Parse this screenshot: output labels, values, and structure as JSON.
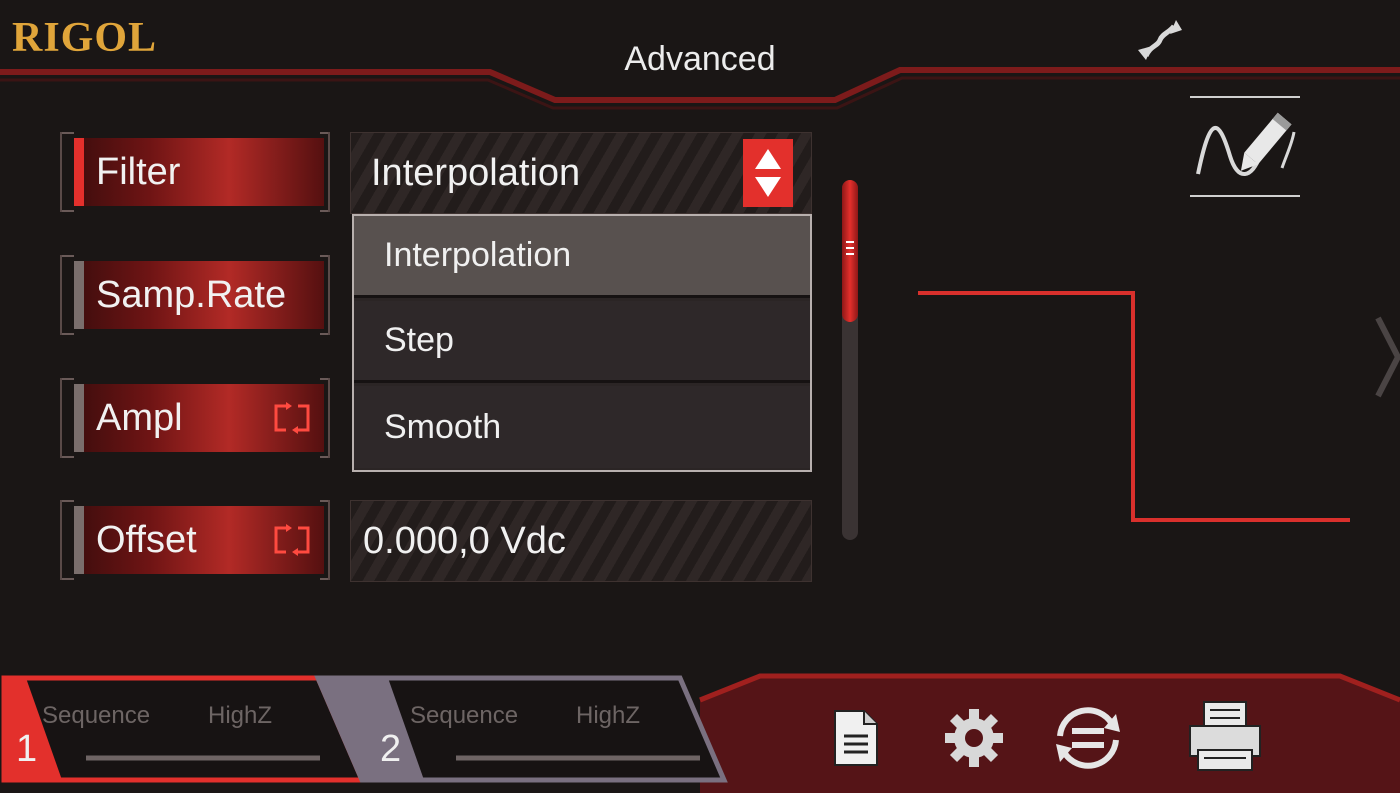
{
  "header": {
    "logo": "RIGOL",
    "title": "Advanced",
    "mode_icon": "mod-arrow-icon",
    "draw_icon": "pencil-wave-icon"
  },
  "params": [
    {
      "key": "filter",
      "label": "Filter",
      "value": "Interpolation",
      "active": true
    },
    {
      "key": "samp_rate",
      "label": "Samp.Rate",
      "value": ""
    },
    {
      "key": "ampl",
      "label": "Ampl",
      "value": "",
      "icon": "swap-icon"
    },
    {
      "key": "offset",
      "label": "Offset",
      "value": "0.000,0 Vdc",
      "icon": "swap-icon"
    }
  ],
  "dropdown": {
    "options": [
      "Interpolation",
      "Step",
      "Smooth"
    ],
    "selected": "Interpolation"
  },
  "scrollbar": {
    "position": 0.0,
    "visible_fraction": 0.4
  },
  "channels": [
    {
      "number": "1",
      "mode": "Sequence",
      "load": "HighZ",
      "color": "#e3302c"
    },
    {
      "number": "2",
      "mode": "Sequence",
      "load": "HighZ",
      "color": "#7a7080"
    }
  ],
  "toolbar": [
    "file-icon",
    "gear-icon",
    "sync-icon",
    "printer-icon"
  ],
  "colors": {
    "accent": "#e3302c",
    "logo": "#e0a53a",
    "background": "#1a1615"
  }
}
